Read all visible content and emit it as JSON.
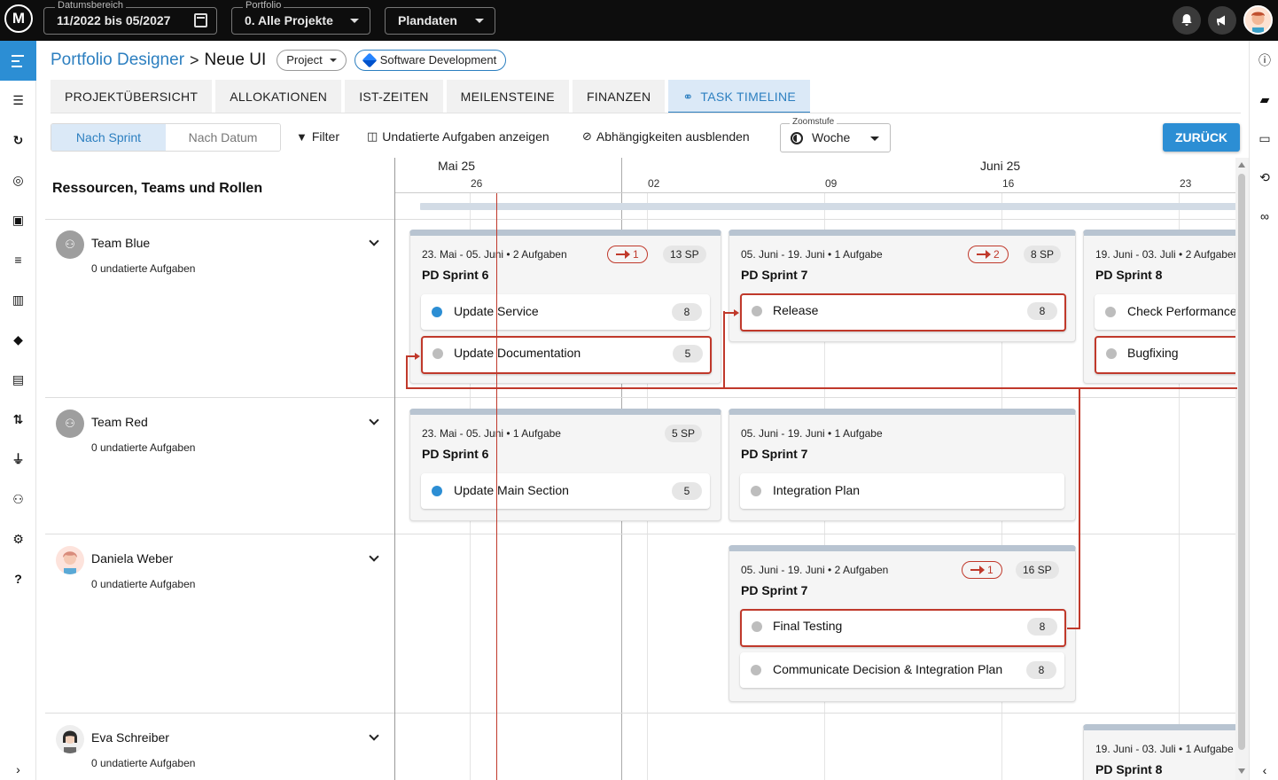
{
  "topbar": {
    "logo": "M",
    "date_range": {
      "label": "Datumsbereich",
      "value": "11/2022 bis 05/2027"
    },
    "portfolio": {
      "label": "Portfolio",
      "value": "0. Alle Projekte"
    },
    "plandaten": "Plandaten"
  },
  "breadcrumb": {
    "root": "Portfolio Designer",
    "separator": ">",
    "current": "Neue UI"
  },
  "chips": {
    "project": "Project",
    "software": "Software Development"
  },
  "tabs": [
    "PROJEKTÜBERSICHT",
    "ALLOKATIONEN",
    "IST-ZEITEN",
    "MEILENSTEINE",
    "FINANZEN",
    "TASK TIMELINE"
  ],
  "toolbar": {
    "seg_sprint": "Nach Sprint",
    "seg_date": "Nach Datum",
    "filter": "Filter",
    "undated": "Undatierte Aufgaben anzeigen",
    "deps": "Abhängigkeiten ausblenden",
    "zoom_label": "Zoomstufe",
    "zoom_value": "Woche",
    "back": "ZURÜCK"
  },
  "gantt": {
    "resources_header": "Ressourcen, Teams und Rollen",
    "months": [
      "Mai 25",
      "Juni 25"
    ],
    "weeks": [
      "26",
      "02",
      "09",
      "16",
      "23"
    ],
    "resources": [
      {
        "name": "Team Blue",
        "sub": "0 undatierte Aufgaben"
      },
      {
        "name": "Team Red",
        "sub": "0 undatierte Aufgaben"
      },
      {
        "name": "Daniela Weber",
        "sub": "0 undatierte Aufgaben"
      },
      {
        "name": "Eva Schreiber",
        "sub": "0 undatierte Aufgaben"
      }
    ],
    "sprints": [
      {
        "meta": "23. Mai - 05. Juni • 2 Aufgaben",
        "title": "PD Sprint 6",
        "deps": "1",
        "sp": "13 SP",
        "tasks": [
          {
            "name": "Update Service",
            "points": "8"
          },
          {
            "name": "Update Documentation",
            "points": "5"
          }
        ]
      },
      {
        "meta": "05. Juni - 19. Juni • 1 Aufgabe",
        "title": "PD Sprint 7",
        "deps": "2",
        "sp": "8 SP",
        "tasks": [
          {
            "name": "Release",
            "points": "8"
          }
        ]
      },
      {
        "meta": "19. Juni - 03. Juli • 2 Aufgaben",
        "title": "PD Sprint 8",
        "tasks": [
          {
            "name": "Check Performance"
          },
          {
            "name": "Bugfixing"
          }
        ]
      },
      {
        "meta": "23. Mai - 05. Juni • 1 Aufgabe",
        "title": "PD Sprint 6",
        "sp": "5 SP",
        "tasks": [
          {
            "name": "Update Main Section",
            "points": "5"
          }
        ]
      },
      {
        "meta": "05. Juni - 19. Juni • 1 Aufgabe",
        "title": "PD Sprint 7",
        "tasks": [
          {
            "name": "Integration Plan"
          }
        ]
      },
      {
        "meta": "05. Juni - 19. Juni • 2 Aufgaben",
        "title": "PD Sprint 7",
        "deps": "1",
        "sp": "16 SP",
        "tasks": [
          {
            "name": "Final Testing",
            "points": "8"
          },
          {
            "name": "Communicate Decision & Integration Plan",
            "points": "8"
          }
        ]
      },
      {
        "meta": "19. Juni - 03. Juli • 1 Aufgabe",
        "title": "PD Sprint 8"
      }
    ]
  },
  "colors": {
    "accent": "#2c8ed4",
    "link": "#2c7fc0",
    "dependency": "#c0392b",
    "topbar": "#0d0d0d"
  }
}
